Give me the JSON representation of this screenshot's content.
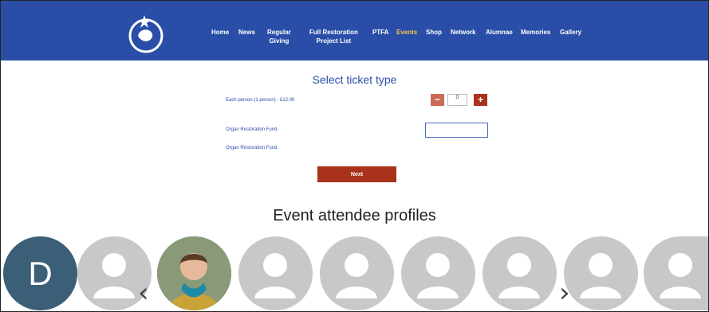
{
  "nav": {
    "links": [
      {
        "label": "Home"
      },
      {
        "label": "News"
      },
      {
        "label": "Regular\nGiving"
      },
      {
        "label": "Full Restoration\nProject List"
      },
      {
        "label": "PTFA"
      },
      {
        "label": "Events",
        "active": true
      },
      {
        "label": "Shop"
      },
      {
        "label": "Network"
      },
      {
        "label": "Alumnae"
      },
      {
        "label": "Memories"
      },
      {
        "label": "Gallery"
      }
    ],
    "colors": {
      "bar": "#2a4ea8",
      "active": "#f2c94c"
    }
  },
  "ticket": {
    "title": "Select ticket type",
    "each_person": "Each person (1 person) - £12.00",
    "quantity": "0",
    "minus_label": "−",
    "plus_label": "+",
    "fund_label": "Organ Restoration Fund.",
    "fund_label_2": "Organ Restoration Fund.",
    "next_label": "Next"
  },
  "profiles": {
    "title": "Event attendee profiles",
    "first_initial": "D",
    "prev_label": "‹",
    "next_label": "›"
  }
}
